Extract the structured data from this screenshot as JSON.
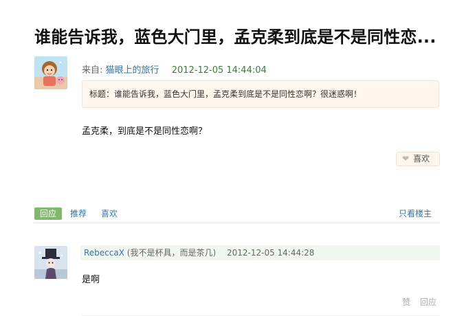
{
  "topic": {
    "title": "谁能告诉我，蓝色大门里，孟克柔到底是不是同性恋...",
    "from_label": "来自:",
    "author": "猫眼上的旅行",
    "date": "2012-12-05 14:44:04",
    "topic_summary": "标题：谁能告诉我，蓝色大门里，孟克柔到底是不是同性恋啊？很迷惑啊！",
    "body": "孟克柔，到底是不是同性恋啊？",
    "like_label": "喜欢"
  },
  "actions": {
    "reply": "回应",
    "recommend": "推荐",
    "like": "喜欢",
    "only_owner": "只看楼主"
  },
  "reply": {
    "author": "RebeccaX",
    "signature": "(我不是杯具，而是茶几)",
    "date": "2012-12-05 14:44:28",
    "body": "是啊",
    "praise": "赞",
    "reply": "回应"
  }
}
